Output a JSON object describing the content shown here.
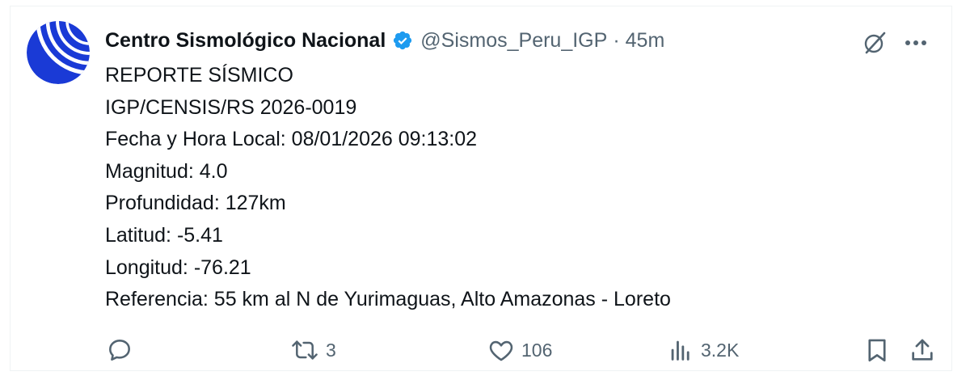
{
  "tweet": {
    "author": {
      "display_name": "Centro Sismológico Nacional",
      "handle": "@Sismos_Peru_IGP",
      "separator": "·",
      "time": "45m",
      "verified": true,
      "avatar": "igp-seismic-logo"
    },
    "lines": [
      "REPORTE SÍSMICO",
      "IGP/CENSIS/RS 2026-0019",
      "Fecha y Hora Local: 08/01/2026 09:13:02",
      "Magnitud: 4.0",
      "Profundidad: 127km",
      "Latitud: -5.41",
      "Longitud: -76.21",
      "Referencia: 55 km al N de Yurimaguas, Alto Amazonas - Loreto"
    ],
    "actions": {
      "reply": {
        "icon": "reply-icon",
        "count": ""
      },
      "repost": {
        "icon": "repost-icon",
        "count": "3"
      },
      "like": {
        "icon": "heart-icon",
        "count": "106"
      },
      "views": {
        "icon": "analytics-icon",
        "count": "3.2K"
      },
      "bookmark": {
        "icon": "bookmark-icon"
      },
      "share": {
        "icon": "share-icon"
      }
    },
    "top_icons": [
      "grok-icon",
      "more-icon"
    ]
  },
  "colors": {
    "text_primary": "#0f1419",
    "text_secondary": "#536471",
    "verified_blue": "#1d9bf0",
    "border": "#eff3f4",
    "avatar_blue": "#1a3ad6"
  }
}
